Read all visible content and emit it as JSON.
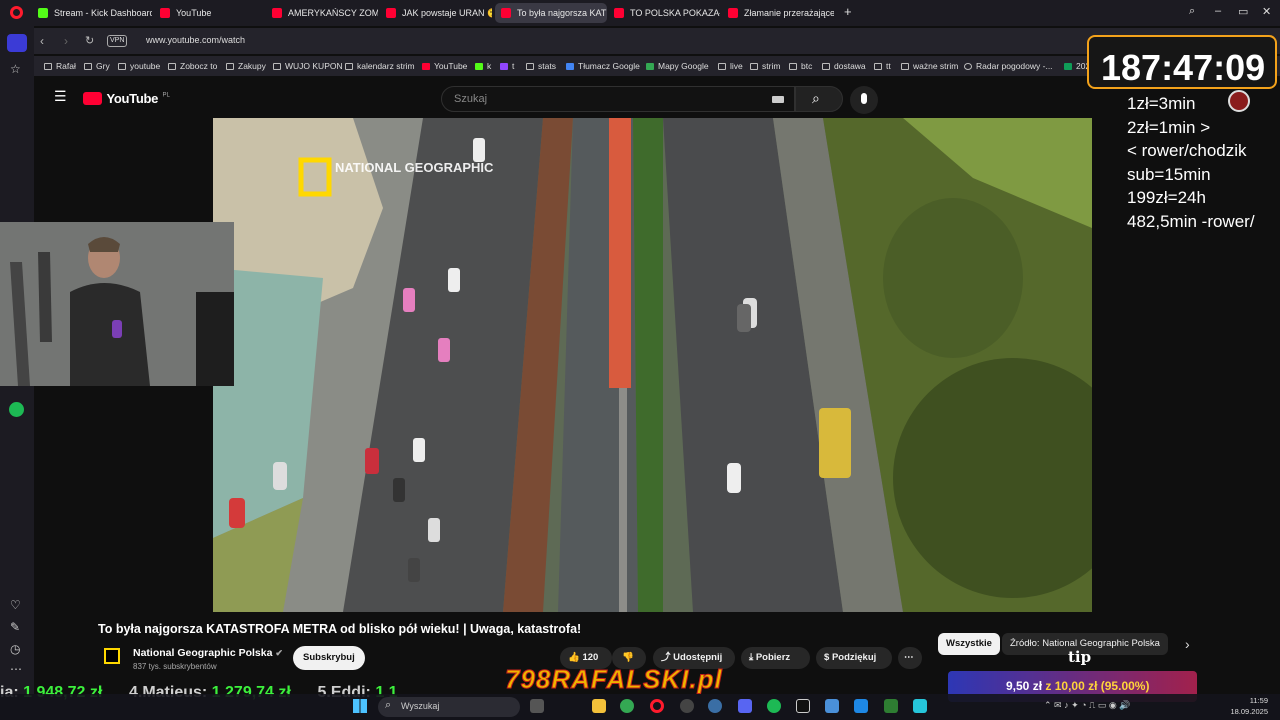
{
  "browser": {
    "tabs": [
      {
        "label": "Stream - Kick Dashboard",
        "color": "#53fc18",
        "active": false
      },
      {
        "label": "YouTube",
        "color": "#ff0033",
        "active": false
      },
      {
        "label": "AMERYKAŃSCY ZOMBIE (",
        "color": "#ff0033",
        "active": false
      },
      {
        "label": "JAK powstaje URAN 😲 |",
        "color": "#ff0033",
        "active": false
      },
      {
        "label": "To była najgorsza KAT",
        "color": "#ff0033",
        "active": true
      },
      {
        "label": "TO POLSKA POKAZAŁA JA",
        "color": "#ff0033",
        "active": false
      },
      {
        "label": "Złamanie przerażającej sz",
        "color": "#ff0033",
        "active": false
      }
    ],
    "new_tab": "+",
    "vpn_label": "VPN",
    "url": "www.youtube.com/watch",
    "bookmarks": [
      "Rafał",
      "Gry",
      "youtube",
      "Zobocz to",
      "Zakupy",
      "WUJO KUPON",
      "kalendarz strim",
      "YouTube",
      "k",
      "t",
      "stats",
      "Tłumacz Google",
      "Mapy Google",
      "live",
      "strim",
      "btc",
      "dostawa",
      "tt",
      "ważne strim",
      "Radar pogodowy -...",
      "2025$ - Arkusze"
    ]
  },
  "youtube": {
    "logo_text": "YouTube",
    "logo_region": "PL",
    "search_placeholder": "Szukaj",
    "video_watermark": "NATIONAL GEOGRAPHIC",
    "title": "To była najgorsza KATASTROFA METRA od blisko pół wieku! | Uwaga, katastrofa!",
    "channel_name": "National Geographic Polska",
    "channel_subs": "837 tys. subskrybentów",
    "subscribe_label": "Subskrybuj",
    "likes": "120",
    "share_label": "Udostępnij",
    "download_label": "Pobierz",
    "thanks_label": "Podziękuj",
    "more_label": "⋯",
    "chips": [
      "Wszystkie",
      "Źródło: National Geographic Polska"
    ],
    "chip_next": "›"
  },
  "overlay": {
    "timer": "187:47:09",
    "rules": [
      "1zł=3min",
      "2zł=1min >",
      "< rower/chodzik",
      "sub=15min",
      "199zł=24h",
      "482,5min -rower/"
    ],
    "tip_label": "tip",
    "donation": {
      "current": "9,50 zł",
      "sep": "z",
      "goal": "10,00 zł",
      "percent": "(95.00%)"
    },
    "ticker": [
      {
        "name": "ia:",
        "amount": "1 948,72 zł"
      },
      {
        "name": "4.Matieus:",
        "amount": "1 279,74 zł"
      },
      {
        "name": "5.Eddi:",
        "amount": "1 1"
      }
    ],
    "brand": "798RAFALSKI.pl"
  },
  "taskbar": {
    "search_placeholder": "Wyszukaj",
    "time": "11:59",
    "date": "18.09.2025"
  }
}
